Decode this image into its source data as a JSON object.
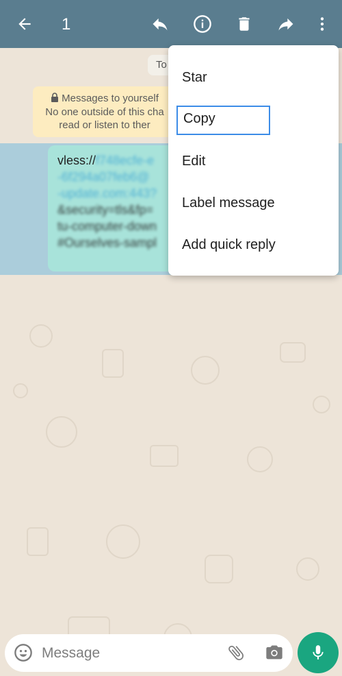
{
  "header": {
    "selected_count": "1",
    "icons": [
      "back-arrow-icon",
      "reply-icon",
      "info-icon",
      "delete-icon",
      "forward-icon",
      "more-vert-icon"
    ]
  },
  "chat": {
    "date_chip": "To",
    "notice_line1": "Messages to yourself",
    "notice_line2": "No one outside of this cha",
    "notice_line3": "read or listen to ther",
    "message_prefix": "vless://",
    "message_blurred_lines": [
      "f748ecfe-e",
      "-6f294a07feb6@",
      "-update.com:443?",
      "&security=tls&fp=",
      "tu-computer-down",
      "#Ourselves-sampl"
    ]
  },
  "context_menu": {
    "items": [
      "Star",
      "Copy",
      "Edit",
      "Label message",
      "Add quick reply"
    ]
  },
  "composer": {
    "placeholder": "Message"
  },
  "colors": {
    "toolbar": "#5a7d8f",
    "selection": "#75b9de",
    "bubble": "#a8e3da",
    "mic": "#1aa680"
  }
}
